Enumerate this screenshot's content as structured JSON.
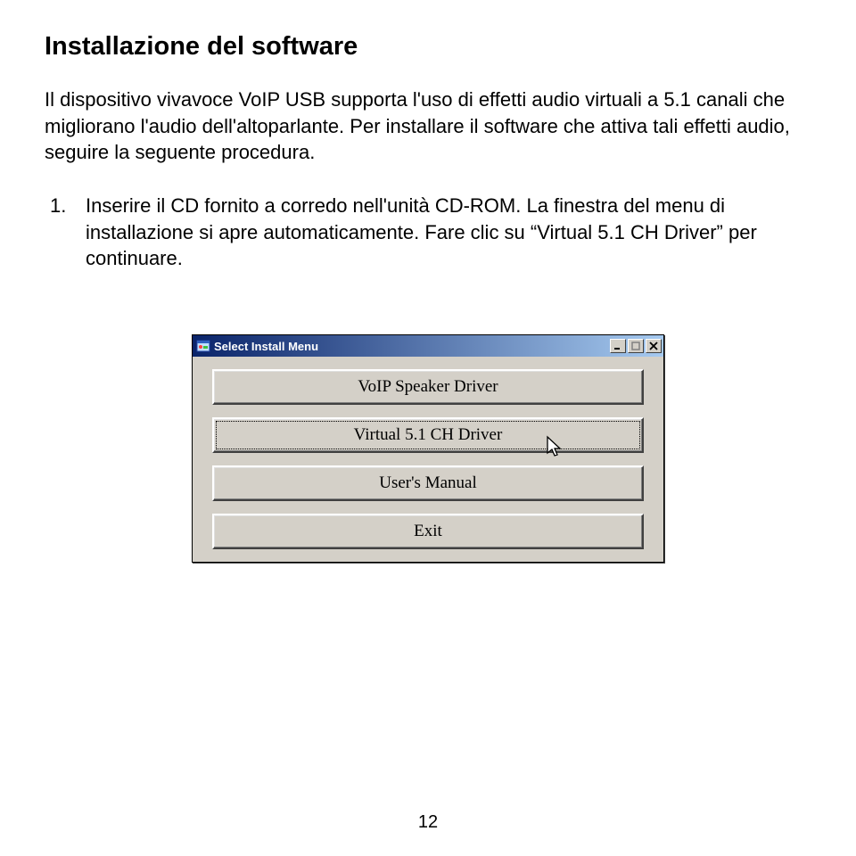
{
  "title": "Installazione del software",
  "intro": "Il dispositivo vivavoce VoIP USB supporta l'uso di effetti audio virtuali a 5.1 canali che migliorano l'audio dell'altoparlante. Per installare il software che attiva tali effetti audio, seguire la seguente procedura.",
  "step_number": "1.",
  "step_text": "Inserire il CD fornito a corredo nell'unità CD-ROM. La finestra del menu di installazione si apre automaticamente. Fare clic su “Virtual 5.1 CH Driver” per continuare.",
  "dialog": {
    "title": "Select Install Menu",
    "buttons": {
      "voip": "VoIP  Speaker  Driver",
      "virtual": "Virtual  5.1  CH Driver",
      "manual": "User's  Manual",
      "exit": "Exit"
    }
  },
  "page_number": "12"
}
